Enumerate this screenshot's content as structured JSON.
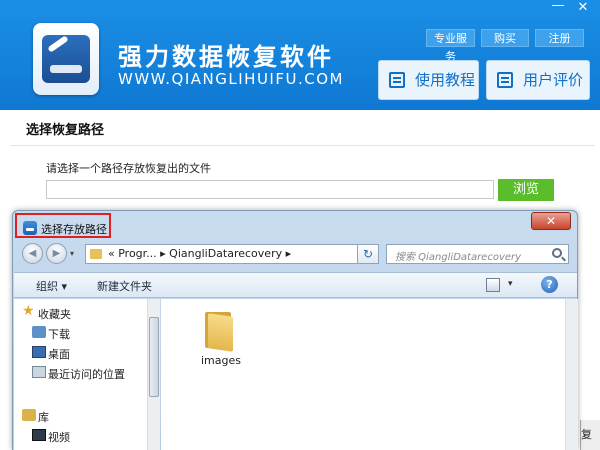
{
  "app": {
    "title": "强力数据恢复软件",
    "url": "WWW.QIANGLIHUIFU.COM",
    "top_links": [
      "专业服务",
      "购买",
      "注册"
    ],
    "window_controls": {
      "minimize": "—",
      "close": "✕"
    },
    "buttons": {
      "tutorial": "使用教程",
      "review": "用户评价"
    }
  },
  "main": {
    "section_title": "选择恢复路径",
    "path_label": "请选择一个路径存放恢复出的文件",
    "path_value": "",
    "browse_button": "浏览",
    "right_stub_text": "复"
  },
  "dialog": {
    "title": "选择存放路径",
    "close": "✕",
    "nav": {
      "back": "◀",
      "forward": "▶",
      "dropdown": "▾",
      "refresh": "↻"
    },
    "address": "« Progr... ▸ QiangliDatarecovery ▸",
    "address_arrow": "▾",
    "search_placeholder": "搜索 QiangliDatarecovery",
    "toolbar": {
      "organize": "组织 ▾",
      "new_folder": "新建文件夹",
      "view_arrow": "▾",
      "help": "?"
    },
    "nav_tree": [
      {
        "label": "收藏夹",
        "icon": "star-icon"
      },
      {
        "label": "下载",
        "icon": "download-folder-icon"
      },
      {
        "label": "桌面",
        "icon": "desktop-icon"
      },
      {
        "label": "最近访问的位置",
        "icon": "recent-places-icon"
      },
      {
        "label": "库",
        "icon": "library-icon"
      },
      {
        "label": "视频",
        "icon": "video-library-icon"
      }
    ],
    "files": [
      {
        "name": "images",
        "icon": "folder-icon"
      }
    ]
  },
  "colors": {
    "header_blue": "#1b8fe6",
    "browse_green": "#5bbd2b",
    "highlight_red": "#e02020"
  }
}
